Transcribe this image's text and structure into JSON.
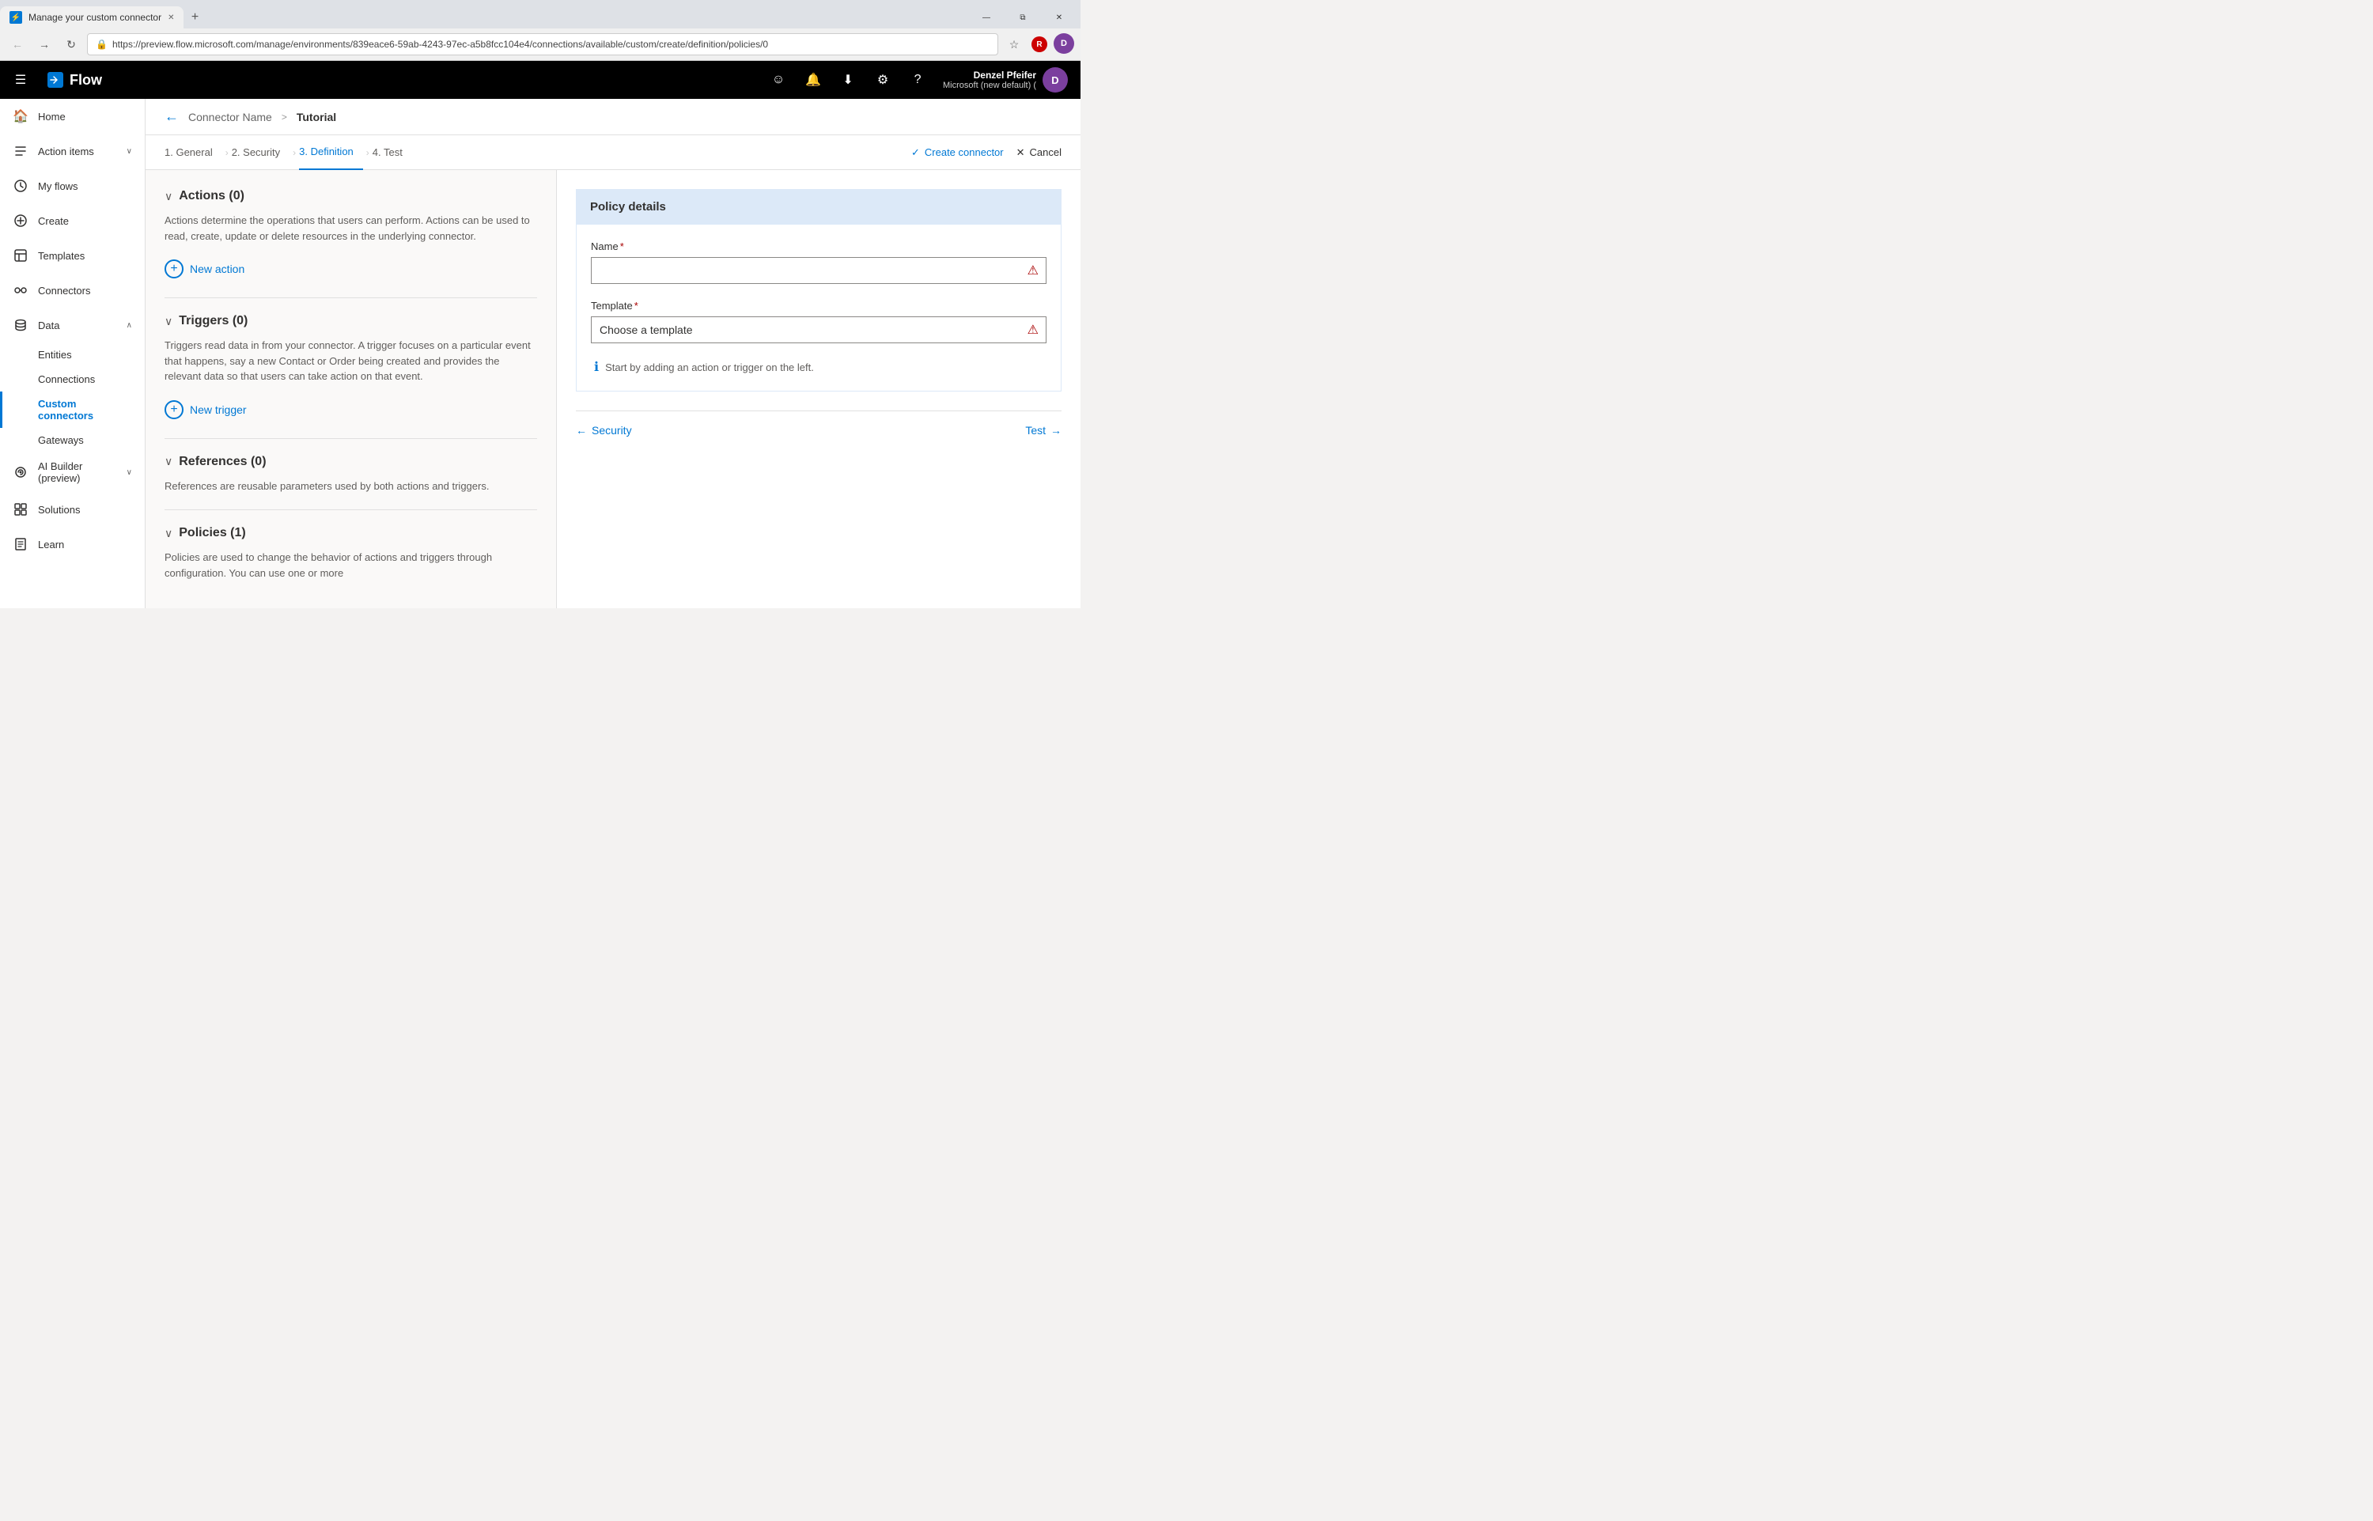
{
  "browser": {
    "tab_title": "Manage your custom connector",
    "tab_favicon": "⚡",
    "url": "https://preview.flow.microsoft.com/manage/environments/839eace6-59ab-4243-97ec-a5b8fcc104e4/connections/available/custom/create/definition/policies/0",
    "new_tab_icon": "+",
    "win_minimize": "—",
    "win_restore": "⧉",
    "win_close": "✕"
  },
  "topnav": {
    "hamburger_icon": "☰",
    "app_name": "Flow",
    "user_name": "Denzel Pfeifer",
    "user_env": "Microsoft (new default) (",
    "user_initials": "D",
    "smiley_icon": "☺",
    "bell_icon": "🔔",
    "download_icon": "⬇",
    "settings_icon": "⚙",
    "help_icon": "?"
  },
  "sidebar": {
    "items": [
      {
        "id": "home",
        "label": "Home",
        "icon": "🏠",
        "active": false
      },
      {
        "id": "action-items",
        "label": "Action items",
        "icon": "✓",
        "active": false,
        "hasChevron": true
      },
      {
        "id": "my-flows",
        "label": "My flows",
        "icon": "↻",
        "active": false
      },
      {
        "id": "create",
        "label": "Create",
        "icon": "+",
        "active": false
      },
      {
        "id": "templates",
        "label": "Templates",
        "icon": "📋",
        "active": false
      },
      {
        "id": "connectors",
        "label": "Connectors",
        "icon": "🔌",
        "active": false
      },
      {
        "id": "data",
        "label": "Data",
        "icon": "📊",
        "active": false,
        "hasChevron": true
      },
      {
        "id": "entities",
        "label": "Entities",
        "icon": "",
        "active": false,
        "sub": true
      },
      {
        "id": "connections",
        "label": "Connections",
        "icon": "",
        "active": false,
        "sub": true
      },
      {
        "id": "custom-connectors",
        "label": "Custom connectors",
        "icon": "",
        "active": true,
        "sub": true
      },
      {
        "id": "gateways",
        "label": "Gateways",
        "icon": "",
        "active": false,
        "sub": true
      },
      {
        "id": "ai-builder",
        "label": "AI Builder (preview)",
        "icon": "🤖",
        "active": false,
        "hasChevron": true
      },
      {
        "id": "solutions",
        "label": "Solutions",
        "icon": "🧩",
        "active": false
      },
      {
        "id": "learn",
        "label": "Learn",
        "icon": "📖",
        "active": false
      }
    ]
  },
  "page_header": {
    "back_label": "←",
    "connector_name_label": "Connector Name",
    "separator": ">",
    "current_page": "Tutorial"
  },
  "steps": [
    {
      "id": "general",
      "label": "1. General",
      "active": false
    },
    {
      "id": "security",
      "label": "2. Security",
      "active": false
    },
    {
      "id": "definition",
      "label": "3. Definition",
      "active": true
    },
    {
      "id": "test",
      "label": "4. Test",
      "active": false
    }
  ],
  "step_actions": {
    "create_connector_label": "Create connector",
    "cancel_label": "Cancel",
    "check_icon": "✓",
    "x_icon": "✕"
  },
  "left_panel": {
    "sections": [
      {
        "id": "actions",
        "title": "Actions (0)",
        "description": "Actions determine the operations that users can perform. Actions can be used to read, create, update or delete resources in the underlying connector.",
        "btn_label": "New action"
      },
      {
        "id": "triggers",
        "title": "Triggers (0)",
        "description": "Triggers read data in from your connector. A trigger focuses on a particular event that happens, say a new Contact or Order being created and provides the relevant data so that users can take action on that event.",
        "btn_label": "New trigger"
      },
      {
        "id": "references",
        "title": "References (0)",
        "description": "References are reusable parameters used by both actions and triggers.",
        "btn_label": null
      },
      {
        "id": "policies",
        "title": "Policies (1)",
        "description": "Policies are used to change the behavior of actions and triggers through configuration. You can use one or more",
        "btn_label": null
      }
    ]
  },
  "right_panel": {
    "policy_details_header": "Policy details",
    "name_label": "Name",
    "name_required": "*",
    "name_placeholder": "",
    "template_label": "Template",
    "template_required": "*",
    "template_placeholder": "Choose a template",
    "info_message": "Start by adding an action or trigger on the left.",
    "nav_back_label": "← Security",
    "nav_forward_label": "Test →"
  }
}
